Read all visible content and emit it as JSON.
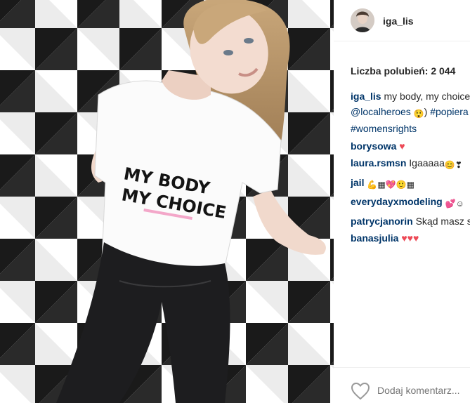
{
  "post": {
    "username": "iga_lis",
    "likes_text": "Liczba polubień: 2 044",
    "shirt_line1": "MY BODY",
    "shirt_line2": "MY CHOICE"
  },
  "caption": {
    "user": "iga_lis",
    "text": " my body, my choice",
    "mention": "@localheroes",
    "hashtag_partial": "#popiera",
    "hashtag2": "#womensrights"
  },
  "comments": [
    {
      "user": "borysowa",
      "text": ""
    },
    {
      "user": "laura.rsmsn",
      "text": " Igaaaaa"
    },
    {
      "user": "jail",
      "text": ""
    },
    {
      "user": "everydayxmodeling",
      "text": ""
    },
    {
      "user": "patrycjanorin",
      "text": " Skąd masz s"
    },
    {
      "user": "banasjulia",
      "text": ""
    }
  ],
  "footer": {
    "placeholder": "Dodaj komentarz..."
  },
  "icons": {
    "like": "heart-outline-icon",
    "comment_heart": "red-heart-icon"
  },
  "colors": {
    "link": "#003569",
    "heart": "#ed4956",
    "text": "#262626"
  }
}
